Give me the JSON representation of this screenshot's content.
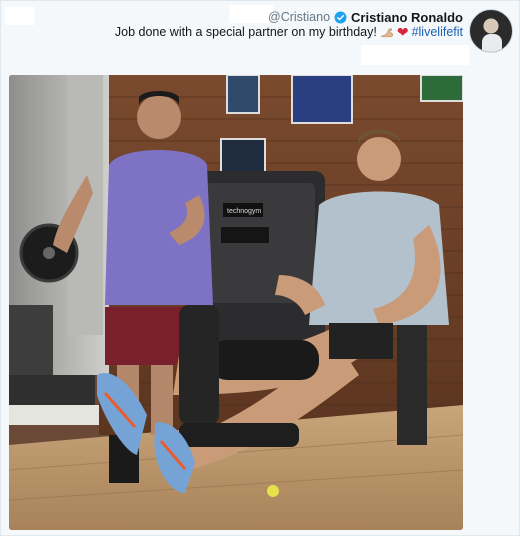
{
  "tweet": {
    "handle": "@Cristiano",
    "display_name": "Cristiano Ronaldo",
    "text": "Job done with a special partner on my birthday!",
    "hashtag": "#livelifefit",
    "emoji": [
      "flexed-biceps-emoji",
      "red-heart-emoji"
    ],
    "verified_color": "#1da1f2",
    "hashtag_color": "#1b5fb5"
  },
  "photo": {
    "subject": "gym-photo",
    "machine_brand_text": "technogym"
  }
}
